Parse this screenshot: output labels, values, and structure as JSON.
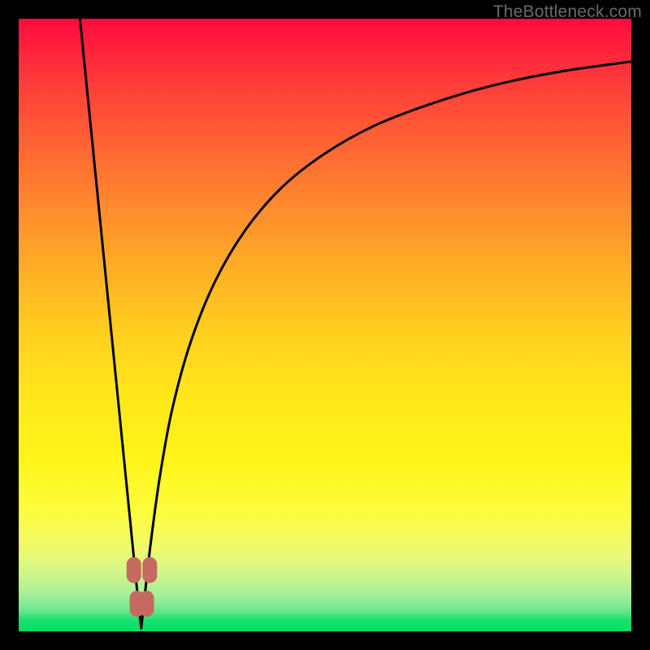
{
  "watermark": "TheBottleneck.com",
  "colors": {
    "frame": "#000000",
    "gradient_top": "#ff0a3e",
    "gradient_mid": "#ffe81a",
    "gradient_bottom": "#00e060",
    "curve_stroke": "#000000",
    "marker_fill": "#c56a60",
    "watermark_text": "#6a6a6a"
  },
  "chart_data": {
    "type": "line",
    "title": "",
    "xlabel": "",
    "ylabel": "",
    "xlim": [
      0,
      100
    ],
    "ylim": [
      0,
      100
    ],
    "x_optimum": 20,
    "series": [
      {
        "name": "left-branch",
        "x": [
          10.0,
          11.0,
          12.0,
          13.0,
          14.0,
          15.0,
          16.0,
          17.0,
          18.0,
          18.8,
          19.4,
          20.0
        ],
        "y": [
          100.0,
          90.0,
          80.0,
          70.0,
          60.0,
          50.0,
          40.0,
          30.0,
          20.0,
          12.0,
          6.0,
          0.5
        ]
      },
      {
        "name": "right-branch",
        "x": [
          20.0,
          20.6,
          21.5,
          23.0,
          25.0,
          28.0,
          32.0,
          37.0,
          43.0,
          50.0,
          58.0,
          67.0,
          77.0,
          88.0,
          100.0
        ],
        "y": [
          0.5,
          6.0,
          14.0,
          25.0,
          36.0,
          47.0,
          57.0,
          65.5,
          72.5,
          78.0,
          82.5,
          86.0,
          89.0,
          91.3,
          93.0
        ]
      }
    ],
    "markers": [
      {
        "name": "opt-left-upper",
        "x": 18.8,
        "y": 10.0
      },
      {
        "name": "opt-left-lower",
        "x": 19.3,
        "y": 4.5
      },
      {
        "name": "opt-right-upper",
        "x": 21.4,
        "y": 10.0
      },
      {
        "name": "opt-right-lower",
        "x": 20.9,
        "y": 4.5
      }
    ]
  }
}
